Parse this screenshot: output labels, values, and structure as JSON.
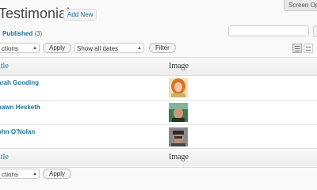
{
  "header": {
    "title": "Testimonials",
    "add_new": "Add New",
    "screen_options": "Screen Opt"
  },
  "status": {
    "published_label": "Published",
    "published_count": "(3)"
  },
  "toolbar_top": {
    "bulk_action": "ctions",
    "apply": "Apply",
    "dates": "Show all dates",
    "filter": "Filter"
  },
  "table": {
    "col_title": "itle",
    "col_image": "Image",
    "rows": [
      {
        "name": "arah Gooding"
      },
      {
        "name": "hawn Hesketh"
      },
      {
        "name": "ohn O'Nolan"
      }
    ]
  },
  "toolbar_bottom": {
    "bulk_action": "ctions",
    "apply": "Apply"
  }
}
